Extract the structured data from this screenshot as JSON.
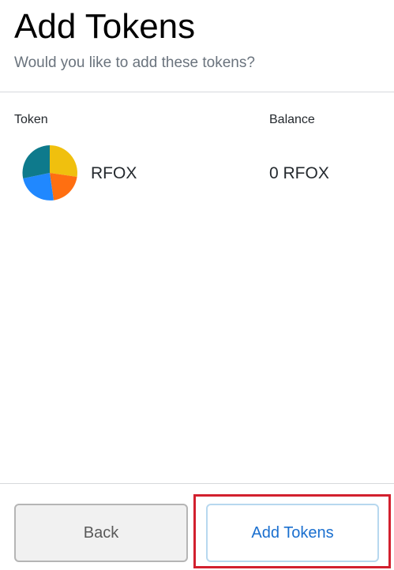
{
  "header": {
    "title": "Add Tokens",
    "subtitle": "Would you like to add these tokens?"
  },
  "table": {
    "columns": [
      "Token",
      "Balance"
    ],
    "rows": [
      {
        "icon": "rfox-pie-token-icon",
        "symbol": "RFOX",
        "balance": "0 RFOX"
      }
    ]
  },
  "footer": {
    "back_label": "Back",
    "add_label": "Add Tokens"
  },
  "colors": {
    "title": "#000000",
    "subtitle": "#6a737d",
    "primary_text": "#24292e",
    "divider": "#d6d9dc",
    "back_bg": "#f1f1f1",
    "back_border": "#b5b5b5",
    "add_border": "#b7d8ef",
    "add_text": "#1a6fcf",
    "highlight": "#d2202e",
    "token_icon": [
      "#f0c00e",
      "#ff6f11",
      "#2088ff",
      "#0e7a8c"
    ]
  }
}
